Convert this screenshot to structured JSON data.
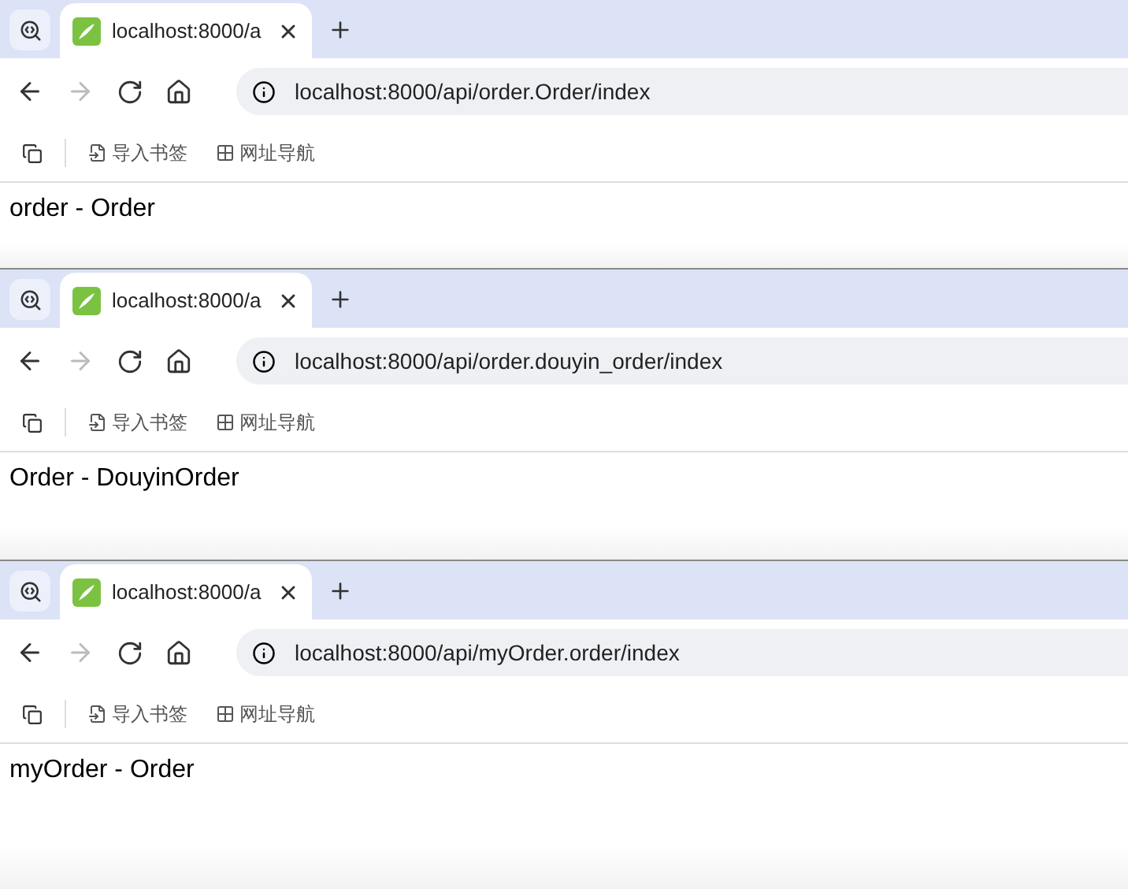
{
  "windows": [
    {
      "tab": {
        "title": "localhost:8000/a",
        "selected": true
      },
      "address": "localhost:8000/api/order.Order/index",
      "bookmarks": [
        "导入书签",
        "网址导航"
      ],
      "page_text": "order - Order"
    },
    {
      "tab": {
        "title": "localhost:8000/a",
        "selected": true
      },
      "address": "localhost:8000/api/order.douyin_order/index",
      "bookmarks": [
        "导入书签",
        "网址导航"
      ],
      "page_text": "Order - DouyinOrder"
    },
    {
      "tab": {
        "title": "localhost:8000/a",
        "selected": true
      },
      "address": "localhost:8000/api/myOrder.order/index",
      "bookmarks": [
        "导入书签",
        "网址导航"
      ],
      "page_text": "myOrder - Order"
    }
  ]
}
